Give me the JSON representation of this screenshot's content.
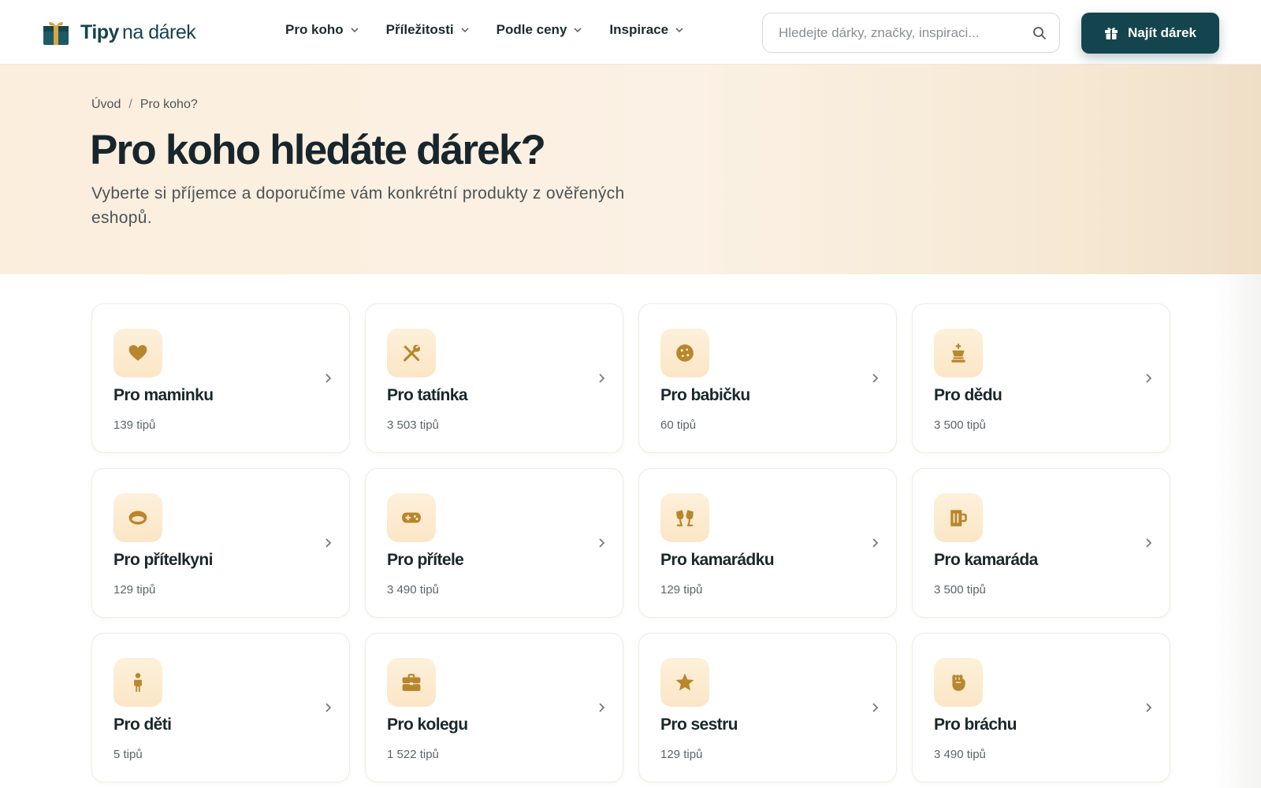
{
  "header": {
    "logo_part1": "Tipy",
    "logo_part2": "na dárek",
    "nav": [
      {
        "label": "Pro koho"
      },
      {
        "label": "Příležitosti"
      },
      {
        "label": "Podle ceny"
      },
      {
        "label": "Inspirace"
      }
    ],
    "search_placeholder": "Hledejte dárky, značky, inspiraci...",
    "cta_label": "Najít dárek"
  },
  "hero": {
    "breadcrumb": [
      "Úvod",
      "Pro koho?"
    ],
    "breadcrumb_separator": "/",
    "title": "Pro koho hledáte dárek?",
    "subtitle": "Vyberte si příjemce a doporučíme vám konkrétní produkty z ověřených eshopů."
  },
  "cards": [
    {
      "title": "Pro maminku",
      "count": "139 tipů",
      "icon": "heart-icon"
    },
    {
      "title": "Pro tatínka",
      "count": "3 503 tipů",
      "icon": "tools-icon"
    },
    {
      "title": "Pro babičku",
      "count": "60 tipů",
      "icon": "cookie-icon"
    },
    {
      "title": "Pro dědu",
      "count": "3 500 tipů",
      "icon": "chess-king-icon"
    },
    {
      "title": "Pro přítelkyni",
      "count": "129 tipů",
      "icon": "ring-icon"
    },
    {
      "title": "Pro přítele",
      "count": "3 490 tipů",
      "icon": "gamepad-icon"
    },
    {
      "title": "Pro kamarádku",
      "count": "129 tipů",
      "icon": "glasses-cheers-icon"
    },
    {
      "title": "Pro kamaráda",
      "count": "3 500 tipů",
      "icon": "beer-mug-icon"
    },
    {
      "title": "Pro děti",
      "count": "5 tipů",
      "icon": "child-icon"
    },
    {
      "title": "Pro kolegu",
      "count": "1 522 tipů",
      "icon": "briefcase-icon"
    },
    {
      "title": "Pro sestru",
      "count": "129 tipů",
      "icon": "star-icon"
    },
    {
      "title": "Pro bráchu",
      "count": "3 490 tipů",
      "icon": "fist-icon"
    }
  ],
  "colors": {
    "brand": "#14454f",
    "accent_icon": "#b8862c",
    "hero_bg": "#fbeedd"
  }
}
